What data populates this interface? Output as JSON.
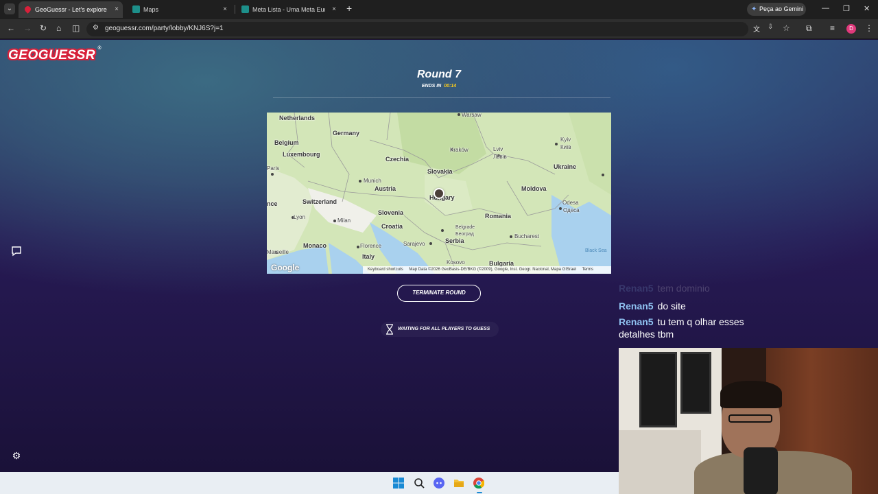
{
  "browser": {
    "tabs": [
      {
        "label": "GeoGuessr - Let's explore the w",
        "active": true
      },
      {
        "label": "Maps",
        "active": false
      },
      {
        "label": "Meta Lista - Uma Meta Europa",
        "active": false
      }
    ],
    "tab_close_glyph": "×",
    "new_tab_glyph": "+",
    "gemini_label": "Peça ao Gemini",
    "url": "geoguessr.com/party/lobby/KNJ6S?j=1",
    "profile_initial": "D"
  },
  "game": {
    "logo": "GEOGUESSR",
    "round_title": "Round 7",
    "ends_label": "ENDS IN",
    "ends_time": "00:14",
    "terminate_label": "TERMINATE ROUND",
    "waiting_label": "WAITING FOR ALL PLAYERS TO GUESS"
  },
  "map": {
    "countries": [
      "Netherlands",
      "Germany",
      "Belgium",
      "Luxembourg",
      "Czechia",
      "Slovakia",
      "Ukraine",
      "Austria",
      "Moldova",
      "Switzerland",
      "Hungary",
      "Slovenia",
      "Croatia",
      "Romania",
      "Serbia",
      "Italy",
      "Bulgaria",
      "Monaco",
      "nce"
    ],
    "cities": [
      "Warsaw",
      "Kraków",
      "Lviv",
      "Львів",
      "Kyiv",
      "Київ",
      "Paris",
      "Munich",
      "Odesa",
      "Одеса",
      "Lyon",
      "Milan",
      "Belgrade",
      "Београд",
      "Marseille",
      "Florence",
      "Sarajevo",
      "Bucharest",
      "Kosovo"
    ],
    "sea": "Black Sea",
    "google": "Google",
    "footer": {
      "shortcuts": "Keyboard shortcuts",
      "attribution": "Map Data ©2026 GeoBasis-DE/BKG (©2009), Google, Inst. Geogr. Nacional, Mapa GISrael",
      "terms": "Terms"
    }
  },
  "chat": [
    {
      "user": "Renan5",
      "text": "tem dominio",
      "faded": true
    },
    {
      "user": "Renan5",
      "text": "do site",
      "faded": false
    },
    {
      "user": "Renan5",
      "text": "tu tem q olhar esses",
      "continuation": "detalhes tbm",
      "faded": false
    }
  ],
  "icons": [
    "back-icon",
    "forward-icon",
    "reload-icon",
    "home-icon",
    "split-icon",
    "translate-icon",
    "install-icon",
    "star-icon",
    "extensions-icon",
    "media-icon",
    "more-icon",
    "chat-bubble-icon",
    "settings-icon",
    "hourglass-icon",
    "windows-start-icon",
    "search-icon",
    "discord-icon",
    "file-explorer-icon",
    "chrome-icon"
  ],
  "colors": {
    "accent": "#fecd19",
    "brand_red": "#d8203a",
    "chat_user": "#8fc1f0"
  }
}
